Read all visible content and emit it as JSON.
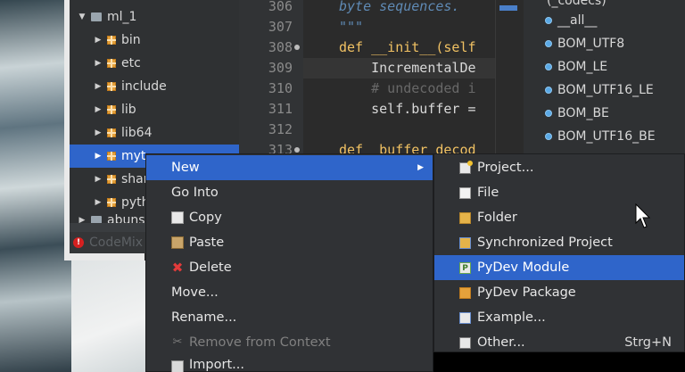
{
  "explorer": {
    "items": [
      {
        "label": "ml_1",
        "expanded": true
      },
      {
        "label": "bin"
      },
      {
        "label": "etc"
      },
      {
        "label": "include"
      },
      {
        "label": "lib"
      },
      {
        "label": "lib64"
      },
      {
        "label": "myt"
      },
      {
        "label": "shar"
      },
      {
        "label": "pyth"
      },
      {
        "label": "abuns"
      }
    ],
    "status_label": "CodeMix"
  },
  "editor": {
    "lines": [
      {
        "num": "306",
        "text": "byte sequences."
      },
      {
        "num": "307",
        "text": "\"\"\""
      },
      {
        "num": "308",
        "text": "def __init__(self"
      },
      {
        "num": "309",
        "text": "    IncrementalDe"
      },
      {
        "num": "310",
        "text": "    # undecoded i"
      },
      {
        "num": "311",
        "text": "    self.buffer ="
      },
      {
        "num": "312",
        "text": ""
      },
      {
        "num": "313",
        "text": "def _buffer_decod"
      }
    ]
  },
  "outline": {
    "items": [
      {
        "label": "(_codecs)"
      },
      {
        "label": "__all__"
      },
      {
        "label": "BOM_UTF8"
      },
      {
        "label": "BOM_LE"
      },
      {
        "label": "BOM_UTF16_LE"
      },
      {
        "label": "BOM_BE"
      },
      {
        "label": "BOM_UTF16_BE"
      }
    ]
  },
  "context_menu": {
    "items": [
      {
        "label": "New",
        "has_submenu": true,
        "hover": true
      },
      {
        "label": "Go Into"
      },
      {
        "label": "Copy",
        "icon": "copy-icon"
      },
      {
        "label": "Paste",
        "icon": "paste-icon"
      },
      {
        "label": "Delete",
        "icon": "delete-icon"
      },
      {
        "label": "Move..."
      },
      {
        "label": "Rename..."
      },
      {
        "label": "Remove from Context",
        "icon": "remove-icon",
        "disabled": true
      },
      {
        "label": "Import...",
        "icon": "import-icon"
      }
    ]
  },
  "sub_menu": {
    "items": [
      {
        "label": "Project...",
        "icon": "project-icon"
      },
      {
        "label": "File",
        "icon": "file-icon"
      },
      {
        "label": "Folder",
        "icon": "folder-icon"
      },
      {
        "label": "Synchronized Project",
        "icon": "sync-icon"
      },
      {
        "label": "PyDev Module",
        "icon": "pymodule-icon",
        "hover": true
      },
      {
        "label": "PyDev Package",
        "icon": "pypackage-icon"
      },
      {
        "label": "Example...",
        "icon": "example-icon"
      },
      {
        "label": "Other...",
        "icon": "other-icon",
        "accelerator": "Strg+N"
      }
    ]
  },
  "colors": {
    "selection": "#2f65ca",
    "menu_bg": "#303235",
    "editor_bg": "#2b2b2b"
  }
}
